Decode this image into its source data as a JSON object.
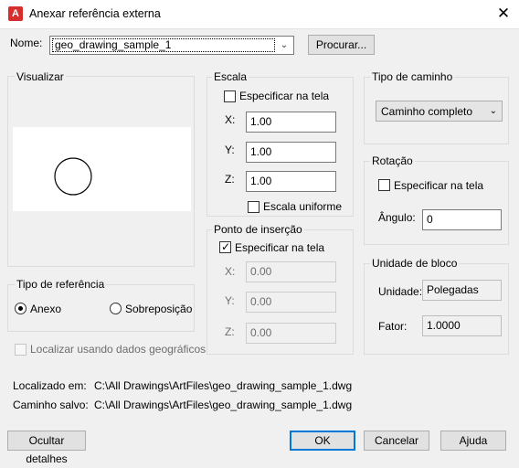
{
  "window": {
    "title": "Anexar referência externa",
    "app_icon_letter": "A",
    "close_symbol": "✕"
  },
  "name_row": {
    "label": "Nome:",
    "value": "geo_drawing_sample_1",
    "browse_label": "Procurar..."
  },
  "preview": {
    "label": "Visualizar"
  },
  "ref_type": {
    "label": "Tipo de referência",
    "attach": "Anexo",
    "overlay": "Sobreposição",
    "selected": "Anexo"
  },
  "geo_locate": {
    "label": "Localizar usando dados geográficos",
    "checked": false,
    "enabled": false
  },
  "scale": {
    "label": "Escala",
    "specify_on_screen": "Especificar na tela",
    "x_label": "X:",
    "x": "1.00",
    "y_label": "Y:",
    "y": "1.00",
    "z_label": "Z:",
    "z": "1.00",
    "uniform": "Escala uniforme"
  },
  "insertion": {
    "label": "Ponto de inserção",
    "specify_on_screen": "Especificar na tela",
    "x_label": "X:",
    "x": "0.00",
    "y_label": "Y:",
    "y": "0.00",
    "z_label": "Z:",
    "z": "0.00"
  },
  "path_type": {
    "label": "Tipo de caminho",
    "value": "Caminho completo"
  },
  "rotation": {
    "label": "Rotação",
    "specify_on_screen": "Especificar na tela",
    "angle_label": "Ângulo:",
    "angle": "0"
  },
  "block_unit": {
    "label": "Unidade de bloco",
    "unit_label": "Unidade:",
    "unit": "Polegadas",
    "factor_label": "Fator:",
    "factor": "1.0000"
  },
  "paths": {
    "found_label": "Localizado em:",
    "found": "C:\\All Drawings\\ArtFiles\\geo_drawing_sample_1.dwg",
    "saved_label": "Caminho salvo:",
    "saved": "C:\\All Drawings\\ArtFiles\\geo_drawing_sample_1.dwg"
  },
  "buttons": {
    "hide_details": "Ocultar detalhes",
    "ok": "OK",
    "cancel": "Cancelar",
    "help": "Ajuda"
  },
  "colors": {
    "accent": "#0078d7",
    "app_icon": "#d62d2d"
  }
}
